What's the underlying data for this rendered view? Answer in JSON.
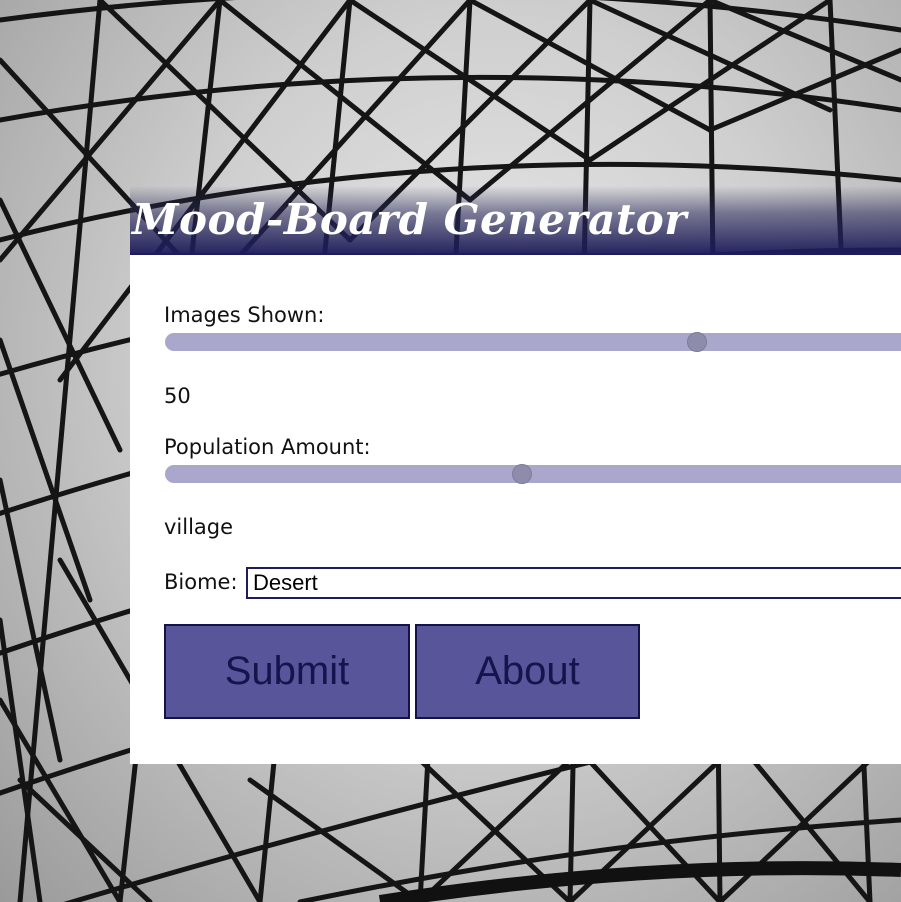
{
  "header": {
    "title": "Mood-Board Generator"
  },
  "form": {
    "images_shown": {
      "label": "Images Shown:",
      "value": "50",
      "slider_fraction": 0.7
    },
    "population_amount": {
      "label": "Population Amount:",
      "value": "village",
      "slider_fraction": 0.47
    },
    "biome": {
      "label": "Biome:",
      "value": "Desert"
    },
    "buttons": {
      "submit_label": "Submit",
      "about_label": "About"
    }
  },
  "colors": {
    "accent": "#58559a",
    "accent_dark": "#1e1b5e",
    "slider_track": "#a9a8cc",
    "slider_thumb": "#8d8cab"
  }
}
